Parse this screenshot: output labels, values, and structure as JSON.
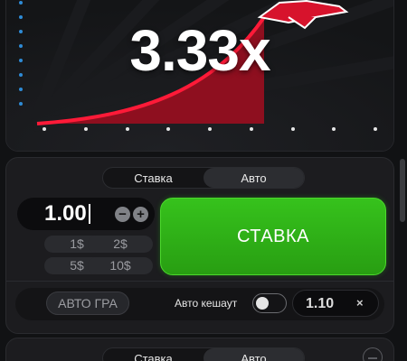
{
  "game": {
    "multiplier": "3.33x",
    "curve_color": "#e0112b",
    "axis_dot_color": "#2e8bd6"
  },
  "bet_panel": {
    "mode_tabs": [
      {
        "label": "Ставка",
        "active": false
      },
      {
        "label": "Авто",
        "active": true
      }
    ],
    "amount": "1.00",
    "minus_symbol": "−",
    "plus_symbol": "+",
    "quick_amounts": [
      "1$",
      "2$",
      "5$",
      "10$"
    ],
    "bet_button_label": "СТАВКА",
    "bet_button_color": "#2fae17",
    "auto_game_label": "АВТО ГРА",
    "auto_cashout_label": "Авто кешаут",
    "auto_cashout_enabled": false,
    "auto_cashout_value": "1.10",
    "clear_symbol": "×"
  },
  "second_panel": {
    "mode_tabs": [
      {
        "label": "Ставка",
        "active": false
      },
      {
        "label": "Авто",
        "active": true
      }
    ]
  }
}
